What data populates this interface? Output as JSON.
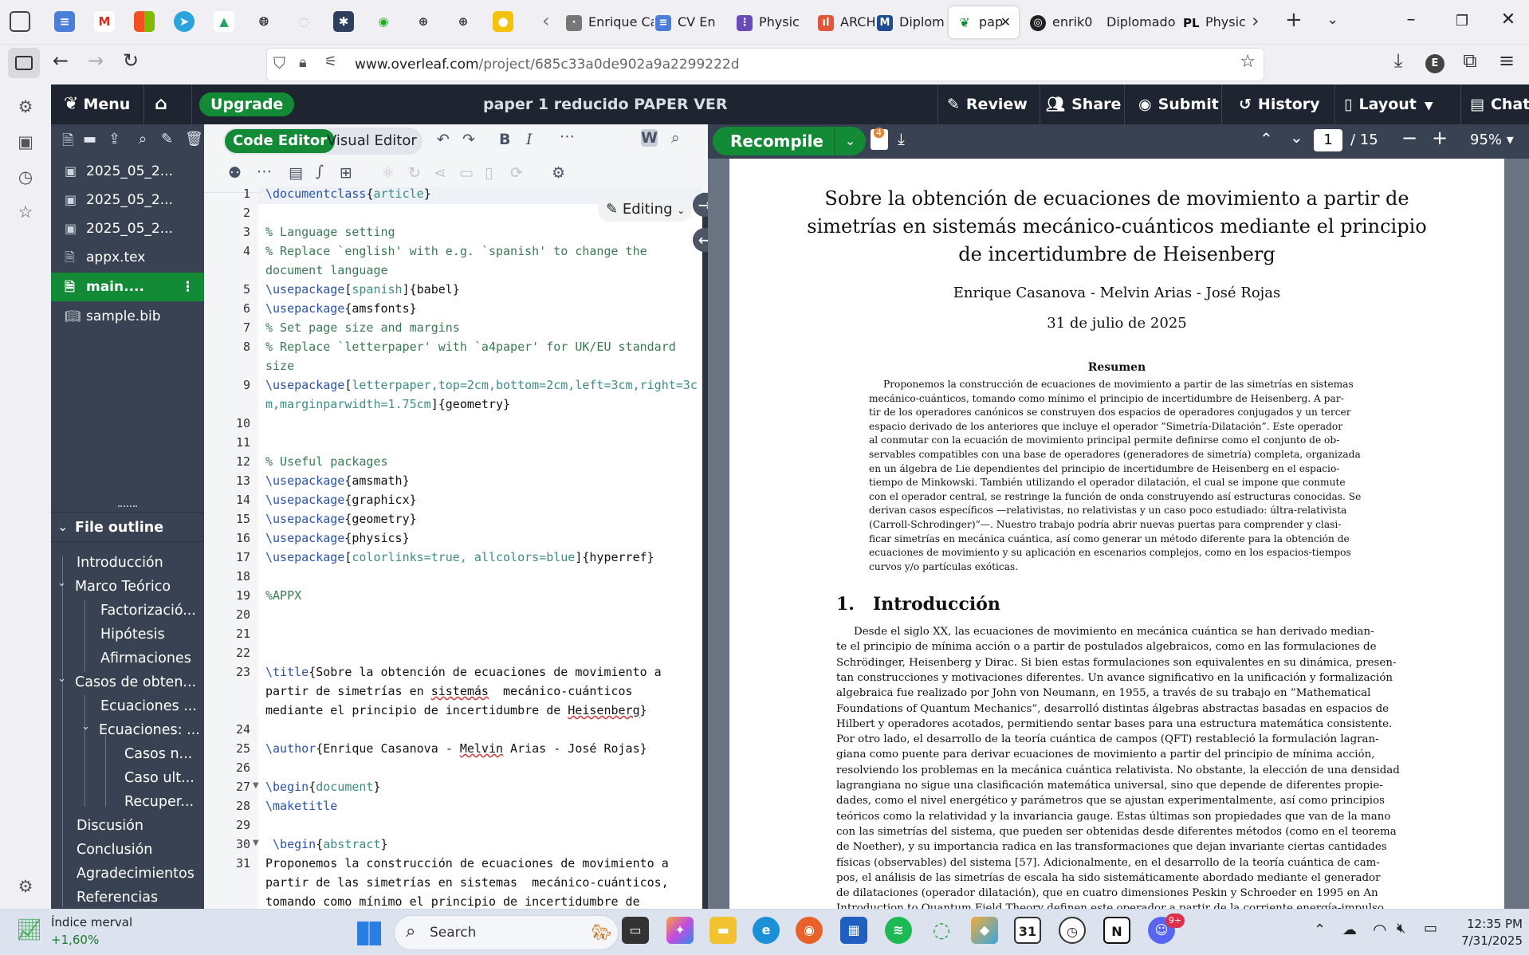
{
  "browser": {
    "tabs": [
      {
        "label": "Enrique Ca",
        "color": "#6d6d6d"
      },
      {
        "label": "CV En",
        "color": "#4a7ed8"
      },
      {
        "label": "Physic",
        "color": "#6a4bb8"
      },
      {
        "label": "ARCH",
        "color": "#e0563c"
      },
      {
        "label": "Diplom",
        "color": "#1f4b8f"
      },
      {
        "label": "pap",
        "color": "#138a36"
      },
      {
        "label": "enrik0",
        "color": "#222222"
      },
      {
        "label": "Diplomado",
        "color": "#3b5998"
      },
      {
        "label": "Physic",
        "color": "#1a1a1a"
      }
    ],
    "close_glyph": "✕",
    "url_host": "www.overleaf.com",
    "url_path": "/project/685c33a0de902a9a2299222d",
    "profile_initial": "E"
  },
  "overleaf": {
    "menu_label": "Menu",
    "upgrade_label": "Upgrade",
    "project_title": "paper 1 reducido PAPER VER",
    "review_label": "Review",
    "share_label": "Share",
    "submit_label": "Submit",
    "history_label": "History",
    "layout_label": "Layout",
    "chat_label": "Chat"
  },
  "filetree": {
    "files": [
      {
        "name": "2025_05_2...",
        "icon": "image-icon"
      },
      {
        "name": "2025_05_2...",
        "icon": "image-icon"
      },
      {
        "name": "2025_05_2...",
        "icon": "image-icon"
      },
      {
        "name": "appx.tex",
        "icon": "file-icon"
      },
      {
        "name": "main....",
        "icon": "file-icon"
      },
      {
        "name": "sample.bib",
        "icon": "book-icon"
      }
    ]
  },
  "outline": {
    "title": "File outline",
    "items": [
      "Introducción",
      "Marco Teórico",
      "Factorizació...",
      "Hipótesis",
      "Afirmaciones",
      "Casos de obten...",
      "Ecuaciones ...",
      "Ecuaciones: ...",
      "Casos n...",
      "Caso ult...",
      "Recuper...",
      "Discusión",
      "Conclusión",
      "Agradecimientos",
      "Referencias"
    ]
  },
  "editor": {
    "code_editor_label": "Code Editor",
    "visual_editor_label": "Visual Editor",
    "editing_label": "Editing",
    "recompile_label": "Recompile",
    "line_numbers": [
      "1",
      "2",
      "3",
      "4",
      "",
      "5",
      "6",
      "7",
      "8",
      "",
      "9",
      "",
      "10",
      "11",
      "12",
      "13",
      "14",
      "15",
      "16",
      "17",
      "18",
      "19",
      "20",
      "21",
      "22",
      "23",
      "",
      "",
      "24",
      "25",
      "26",
      "27",
      "28",
      "29",
      "30",
      "31",
      "",
      ""
    ]
  },
  "pdf": {
    "badge": "4",
    "page_current": "1",
    "page_total": "/ 15",
    "zoom": "95%",
    "title_lines": [
      "Sobre la obtención de ecuaciones de movimiento a partir de",
      "simetrías en sistemás mecánico-cuánticos mediante el principio",
      "de incertidumbre de Heisenberg"
    ],
    "authors": "Enrique Casanova - Melvin Arias - José Rojas",
    "date": "31 de julio de 2025",
    "abstract_title": "Resumen",
    "abstract_lines": [
      "Proponemos la construcción de ecuaciones de movimiento a partir de las simetrías en sistemas",
      "mecánico-cuánticos, tomando como mínimo el principio de incertidumbre de Heisenberg. A par-",
      "tir de los operadores canónicos se construyen dos espacios de operadores conjugados y un tercer",
      "espacio derivado de los anteriores que incluye el operador ”Simetría-Dilatación”. Este operador",
      "al conmutar con la ecuación de movimiento principal permite definirse como el conjunto de ob-",
      "servables compatibles con una base de operadores (generadores de simetría) completa, organizada",
      "en un álgebra de Lie dependientes del principio de incertidumbre de Heisenberg en el espacio-",
      "tiempo de Minkowski. También utilizando el operador dilatación, el cual se impone que conmute",
      "con el operador central, se restringe la función de onda construyendo así estructuras conocidas. Se",
      "derivan casos específicos —relativistas, no relativistas y un caso poco estudiado: últra-relativista",
      "(Carroll-Schrodinger)”—. Nuestro trabajo podría abrir nuevas puertas para comprender y clasi-",
      "ficar simetrías en mecánica cuántica, así como generar un método diferente para la obtención de",
      "ecuaciones de movimiento y su aplicación en escenarios complejos, como en los espacios-tiempos",
      "curvos y/o partículas exóticas."
    ],
    "section_number": "1.",
    "section_title": "Introducción",
    "body_lines": [
      "Desde el siglo XX, las ecuaciones de movimiento en mecánica cuántica se han derivado median-",
      "te el principio de mínima acción o a partir de postulados algebraicos, como en las formulaciones de",
      "Schrödinger, Heisenberg y Dirac. Si bien estas formulaciones son equivalentes en su dinámica, presen-",
      "tan construcciones y motivaciones diferentes. Un avance significativo en la unificación y formalización",
      "algebraica fue realizado por John von Neumann, en 1955, a través de su trabajo en ”Mathematical",
      "Foundations of Quantum Mechanics”, desarrolló distintas álgebras abstractas basadas en espacios de",
      "Hilbert y operadores acotados, permitiendo sentar bases para una estructura matemática consistente.",
      "Por otro lado, el desarrollo de la teoría cuántica de campos (QFT) restableció la formulación lagran-",
      "giana como puente para derivar ecuaciones de movimiento a partir del principio de mínima acción,",
      "resolviendo los problemas en la mecánica cuántica relativista. No obstante, la elección de una densidad",
      "lagrangiana no sigue una clasificación matemática universal, sino que depende de diferentes propie-",
      "dades, como el nivel energético y parámetros que se ajustan experimentalmente, así como principios",
      "teóricos como la relatividad y la invariancia gauge. Estas últimas son propiedades que van de la mano",
      "con las simetrías del sistema, que pueden ser obtenidas desde diferentes métodos (como en el teorema",
      "de Noether), y su importancia radica en las transformaciones que dejan invariante ciertas cantidades",
      "físicas (observables) del sistema [57]. Adicionalmente, en el desarrollo de la teoría cuántica de cam-",
      "pos, el análisis de las simetrías de escala ha sido sistemáticamente abordado mediante el generador",
      "de dilataciones (operador dilatación), que en cuatro dimensiones Peskin y Schroeder en 1995 en An",
      "Introduction to Quantum Field Theory definen este operador a partir de la corriente energía-impulso"
    ]
  },
  "taskbar": {
    "widget_title": "Índice merval",
    "widget_value": "+1,60%",
    "search_label": "Search",
    "notif_badge": "9+",
    "time": "12:35 PM",
    "date": "7/31/2025"
  }
}
